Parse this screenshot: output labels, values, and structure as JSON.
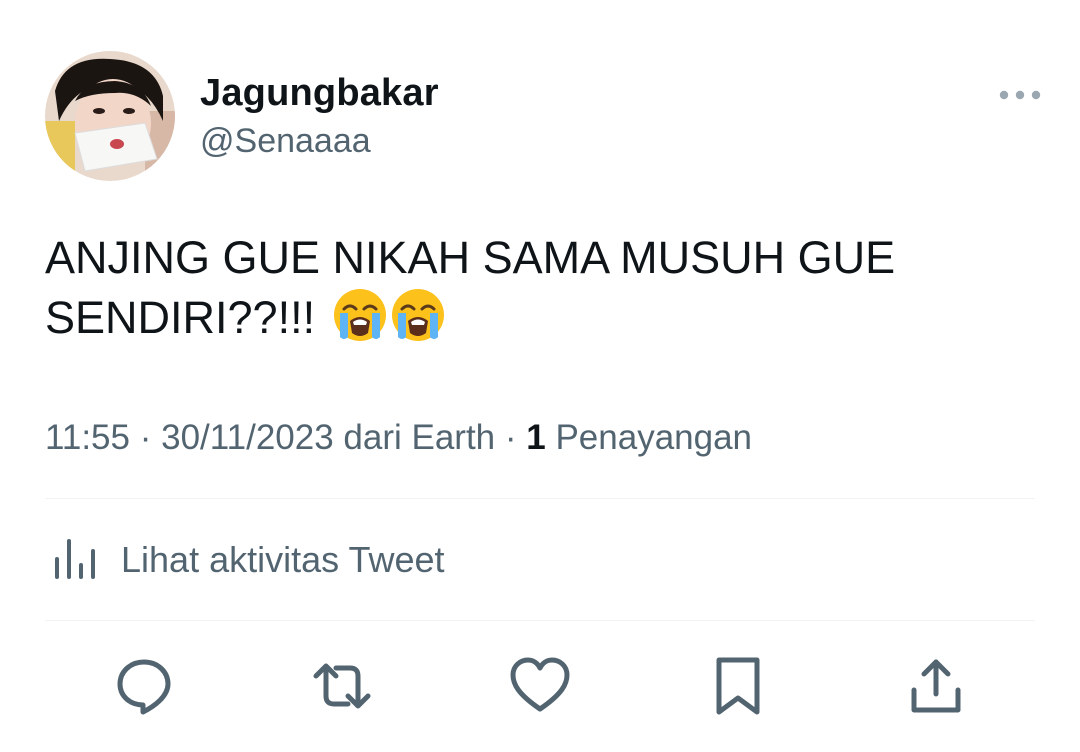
{
  "user": {
    "display_name": "Jagungbakar",
    "handle": "@Senaaaa",
    "avatar": "profile-photo"
  },
  "tweet": {
    "text": "ANJING GUE NIKAH SAMA MUSUH GUE SENDIRI??!!!",
    "emojis": [
      "loudly-crying-face",
      "loudly-crying-face"
    ]
  },
  "meta": {
    "time": "11:55",
    "sep1": " · ",
    "date": "30/11/2023",
    "source": " dari Earth",
    "sep2": " · ",
    "views_count": "1",
    "views_label": " Penayangan"
  },
  "activity": {
    "label": "Lihat aktivitas Tweet",
    "icon": "bar-chart-icon"
  },
  "actions": [
    {
      "icon": "reply-icon"
    },
    {
      "icon": "retweet-icon"
    },
    {
      "icon": "like-icon"
    },
    {
      "icon": "bookmark-icon"
    },
    {
      "icon": "share-icon"
    }
  ],
  "colors": {
    "text_primary": "#0f1419",
    "text_secondary": "#536471",
    "divider": "#eff3f4"
  }
}
